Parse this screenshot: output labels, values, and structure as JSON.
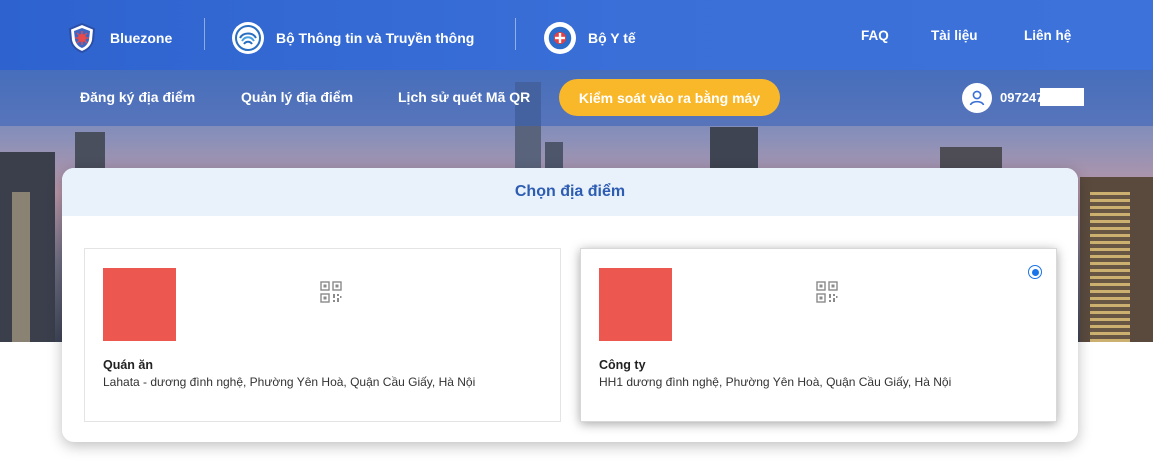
{
  "topbar": {
    "brand1": "Bluezone",
    "brand2": "Bộ Thông tin và Truyền thông",
    "brand3": "Bộ Y tế",
    "links": [
      "FAQ",
      "Tài liệu",
      "Liên hệ"
    ]
  },
  "subnav": {
    "links": [
      "Đăng ký địa điểm",
      "Quản lý địa điểm",
      "Lịch sử quét Mã QR"
    ],
    "cta": "Kiểm soát vào ra bằng máy",
    "user_phone": "097247"
  },
  "card": {
    "title": "Chọn địa điểm",
    "locations": [
      {
        "title": "Quán ăn",
        "address": "Lahata - dương đình nghệ, Phường Yên Hoà, Quận Cầu Giấy, Hà Nội",
        "selected": false
      },
      {
        "title": "Công ty",
        "address": "HH1 dương đình nghệ, Phường Yên Hoà, Quận Cầu Giấy, Hà Nội",
        "selected": true
      }
    ]
  },
  "colors": {
    "brand_blue": "#2e63cf",
    "cta_yellow": "#f9b82a",
    "thumb_red": "#ec5750",
    "heading_blue": "#2d5db2",
    "radio_blue": "#1a73e8"
  },
  "icons": {
    "brand1": "bluezone-shield-icon",
    "brand2": "ministry-info-logo-icon",
    "brand3": "ministry-health-logo-icon",
    "user": "user-icon",
    "qr": "qr-code-icon"
  }
}
